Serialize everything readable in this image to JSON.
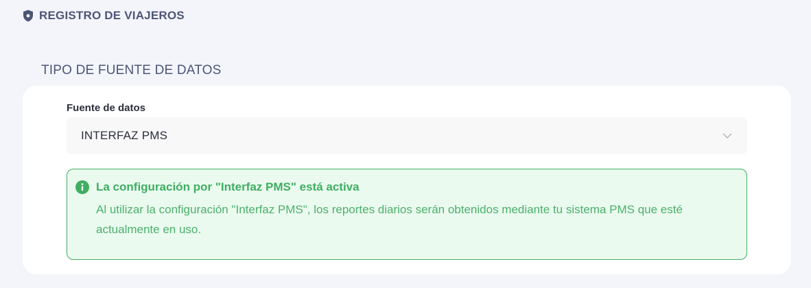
{
  "header": {
    "icon": "shield-icon",
    "title": "REGISTRO DE VIAJEROS"
  },
  "section": {
    "title": "TIPO DE FUENTE DE DATOS"
  },
  "form": {
    "source_label": "Fuente de datos",
    "source_value": "INTERFAZ PMS",
    "dropdown_icon": "chevron-down-icon"
  },
  "alert": {
    "icon": "info-icon",
    "title": "La configuración por \"Interfaz PMS\" está activa",
    "text": "Al utilizar la configuración \"Interfaz PMS\", los reportes diarios serán obtenidos mediante tu sistema PMS que esté actualmente en uso."
  },
  "colors": {
    "background": "#f3f5fb",
    "heading": "#4d5576",
    "success": "#3fae61",
    "success_bg": "#eafaef"
  }
}
